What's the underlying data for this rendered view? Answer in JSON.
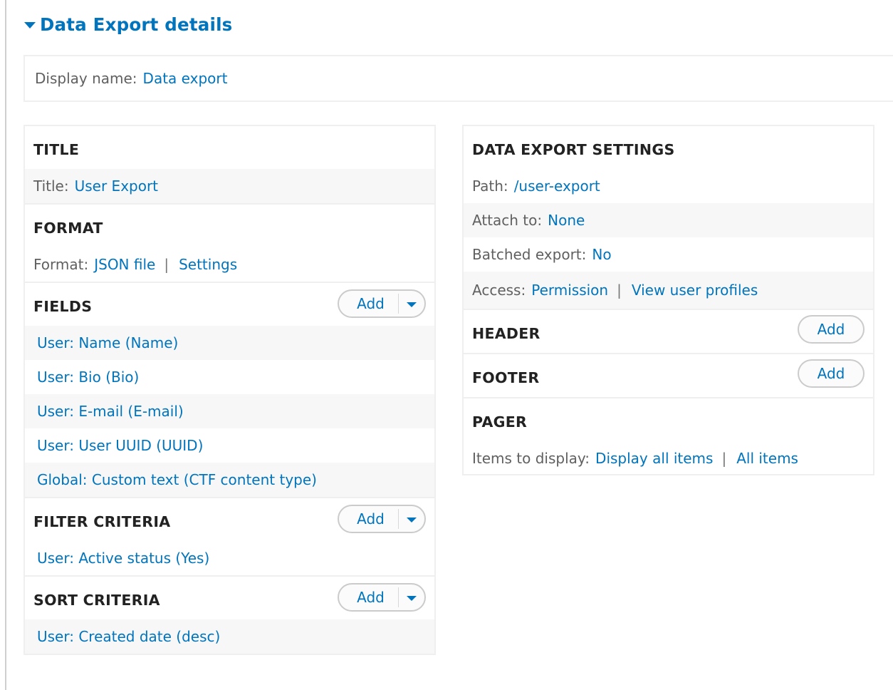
{
  "details": {
    "title": "Data Export details",
    "display_name_label": "Display name:",
    "display_name_value": "Data export"
  },
  "left": {
    "title": {
      "heading": "TITLE",
      "label": "Title:",
      "value": "User Export"
    },
    "format": {
      "heading": "FORMAT",
      "label": "Format:",
      "value": "JSON file",
      "separator": "|",
      "settings": "Settings"
    },
    "fields": {
      "heading": "FIELDS",
      "add_label": "Add",
      "items": [
        "User: Name (Name)",
        "User: Bio (Bio)",
        "User: E-mail (E-mail)",
        "User: User UUID (UUID)",
        "Global: Custom text (CTF content type)"
      ]
    },
    "filter": {
      "heading": "FILTER CRITERIA",
      "add_label": "Add",
      "items": [
        "User: Active status (Yes)"
      ]
    },
    "sort": {
      "heading": "SORT CRITERIA",
      "add_label": "Add",
      "items": [
        "User: Created date (desc)"
      ]
    }
  },
  "right": {
    "settings": {
      "heading": "DATA EXPORT SETTINGS",
      "path_label": "Path:",
      "path_value": "/user-export",
      "attach_label": "Attach to:",
      "attach_value": "None",
      "batched_label": "Batched export:",
      "batched_value": "No",
      "access_label": "Access:",
      "access_value": "Permission",
      "separator": "|",
      "access_detail": "View user profiles"
    },
    "header": {
      "heading": "HEADER",
      "add_label": "Add"
    },
    "footer": {
      "heading": "FOOTER",
      "add_label": "Add"
    },
    "pager": {
      "heading": "PAGER",
      "label": "Items to display:",
      "value": "Display all items",
      "separator": "|",
      "detail": "All items"
    }
  },
  "colors": {
    "link": "#0074bd",
    "heading": "#222222",
    "label": "#606060",
    "border": "#efefef",
    "alt_row": "#f7f7f7"
  }
}
